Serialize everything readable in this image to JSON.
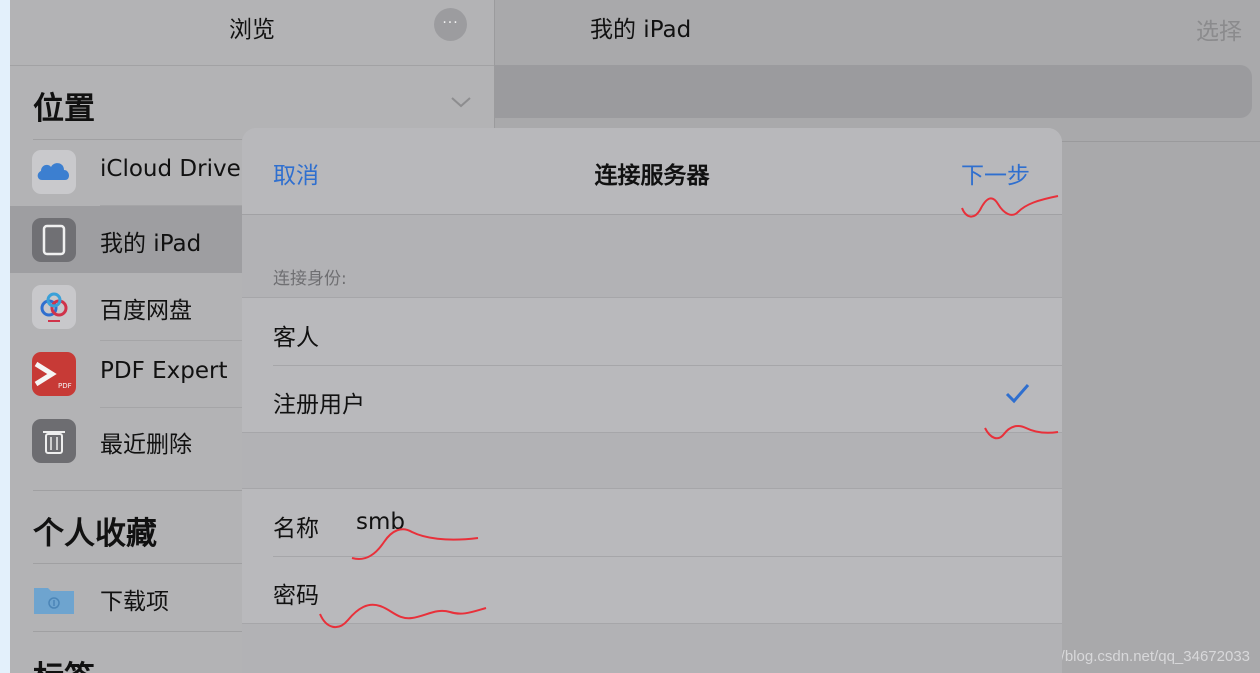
{
  "sidebar": {
    "title": "浏览",
    "more_label": "···",
    "locations_title": "位置",
    "favorites_title": "个人收藏",
    "tags_title": "标签",
    "locations": [
      {
        "label": "iCloud Drive",
        "icon": "icloud-icon"
      },
      {
        "label": "我的 iPad",
        "icon": "ipad-icon",
        "selected": true
      },
      {
        "label": "百度网盘",
        "icon": "baidu-netdisk-icon"
      },
      {
        "label": "PDF Expert",
        "icon": "pdf-expert-icon"
      },
      {
        "label": "最近删除",
        "icon": "trash-icon"
      }
    ],
    "favorites": [
      {
        "label": "下载项",
        "icon": "downloads-folder-icon"
      }
    ]
  },
  "main": {
    "title": "我的 iPad",
    "select_label": "选择"
  },
  "modal": {
    "cancel_label": "取消",
    "title": "连接服务器",
    "next_label": "下一步",
    "connect_as_label": "连接身份:",
    "options": [
      {
        "label": "客人",
        "checked": false
      },
      {
        "label": "注册用户",
        "checked": true
      }
    ],
    "fields": {
      "name_label": "名称",
      "name_value": "smb",
      "password_label": "密码",
      "password_value": ""
    }
  },
  "watermark": "https://blog.csdn.net/qq_34672033",
  "colors": {
    "accent": "#2f6fcf",
    "annotation": "#e8303a"
  }
}
